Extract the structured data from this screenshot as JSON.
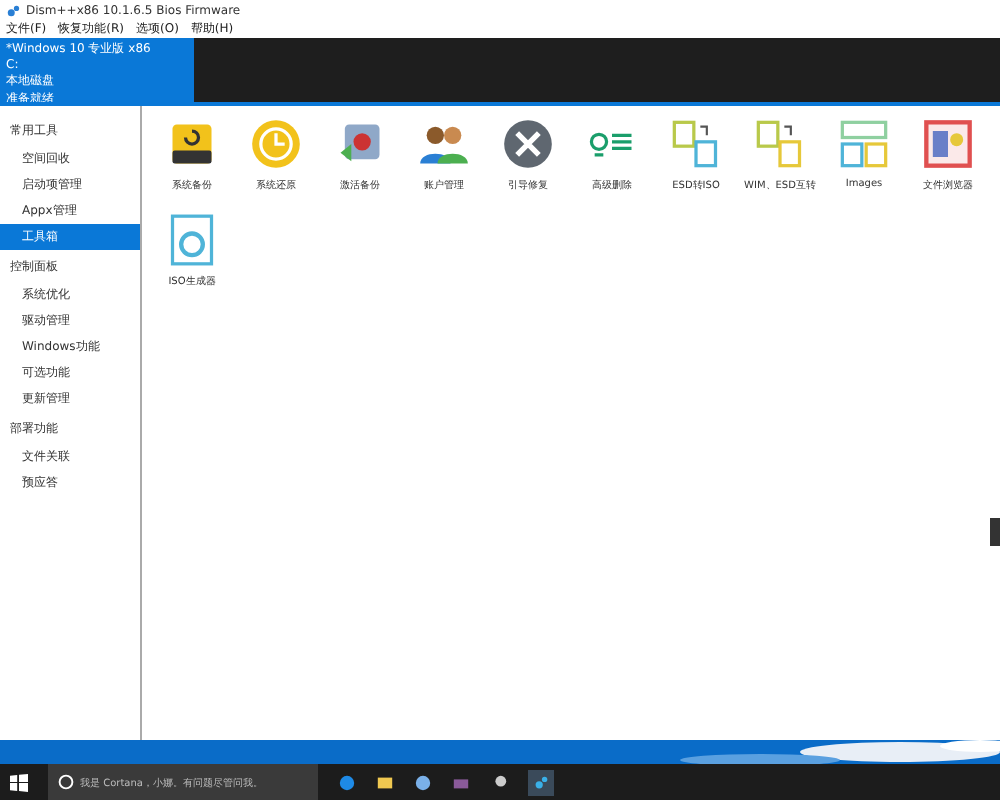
{
  "window": {
    "title": "Dism++x86 10.1.6.5 Bios Firmware"
  },
  "menu": [
    "文件(F)",
    "恢复功能(R)",
    "选项(O)",
    "帮助(H)"
  ],
  "session": {
    "lines": [
      "*Windows 10 专业版 x86",
      "C:",
      "本地磁盘",
      "准备就绪"
    ]
  },
  "sidebar": {
    "groups": [
      {
        "title": "常用工具",
        "items": [
          {
            "label": "空间回收",
            "selected": false
          },
          {
            "label": "启动项管理",
            "selected": false
          },
          {
            "label": "Appx管理",
            "selected": false
          },
          {
            "label": "工具箱",
            "selected": true
          }
        ]
      },
      {
        "title": "控制面板",
        "items": [
          {
            "label": "系统优化",
            "selected": false
          },
          {
            "label": "驱动管理",
            "selected": false
          },
          {
            "label": "Windows功能",
            "selected": false
          },
          {
            "label": "可选功能",
            "selected": false
          },
          {
            "label": "更新管理",
            "selected": false
          }
        ]
      },
      {
        "title": "部署功能",
        "items": [
          {
            "label": "文件关联",
            "selected": false
          },
          {
            "label": "预应答",
            "selected": false
          }
        ]
      }
    ]
  },
  "tools": [
    {
      "kind": "drive",
      "label": "系统备份"
    },
    {
      "kind": "clock",
      "label": "系统还原"
    },
    {
      "kind": "swap",
      "label": "激活备份"
    },
    {
      "kind": "users",
      "label": "账户管理"
    },
    {
      "kind": "wrench",
      "label": "引导修复"
    },
    {
      "kind": "list",
      "label": "高级删除"
    },
    {
      "kind": "esd",
      "label": "ESD转ISO"
    },
    {
      "kind": "wim",
      "label": "WIM、ESD互转"
    },
    {
      "kind": "images",
      "label": "Images"
    },
    {
      "kind": "browser",
      "label": "文件浏览器"
    },
    {
      "kind": "iso",
      "label": "ISO生成器"
    }
  ],
  "taskbar": {
    "search_placeholder": "我是 Cortana，小娜。有问题尽管问我。"
  }
}
